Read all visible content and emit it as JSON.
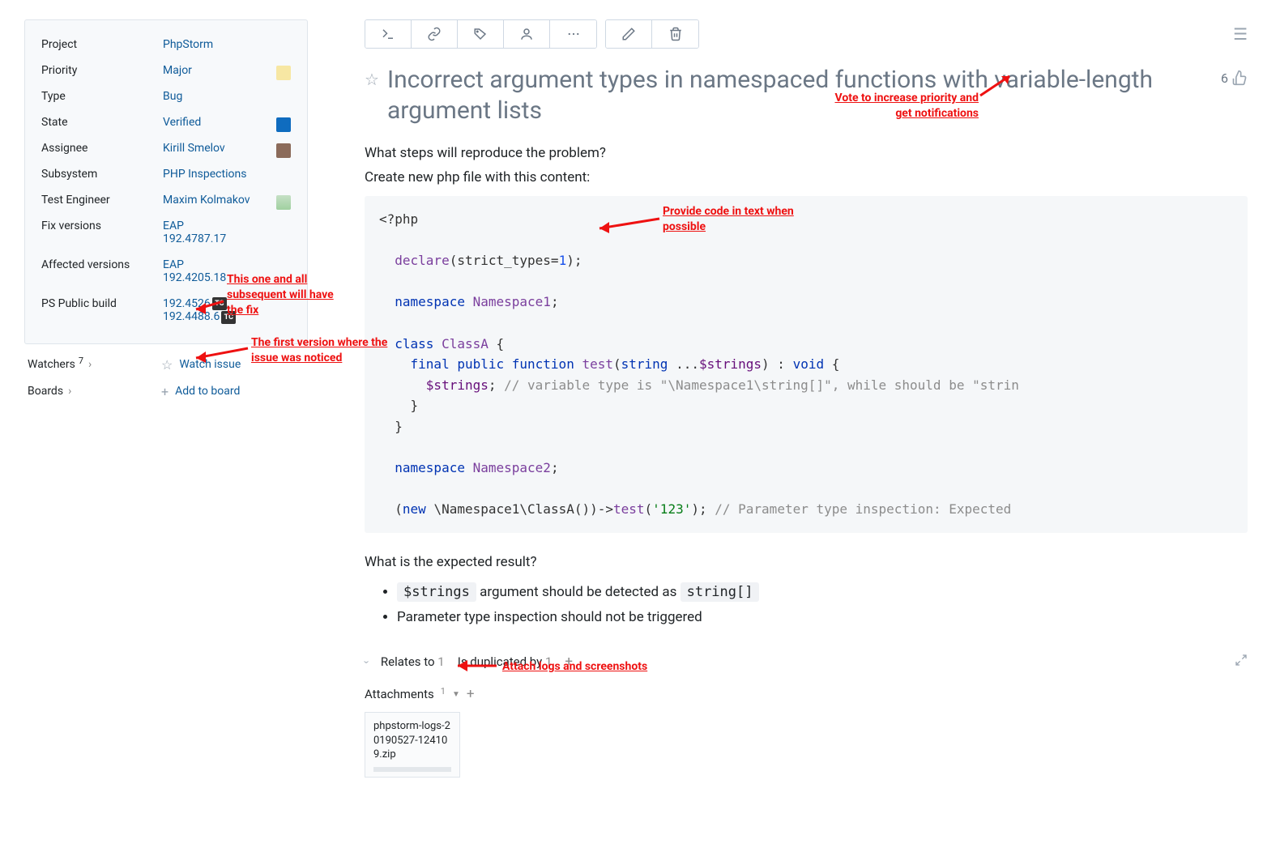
{
  "sidebar": {
    "fields": {
      "project": {
        "label": "Project",
        "value": "PhpStorm"
      },
      "priority": {
        "label": "Priority",
        "value": "Major"
      },
      "type": {
        "label": "Type",
        "value": "Bug"
      },
      "state": {
        "label": "State",
        "value": "Verified"
      },
      "assignee": {
        "label": "Assignee",
        "value": "Kirill Smelov"
      },
      "subsystem": {
        "label": "Subsystem",
        "value": "PHP Inspections"
      },
      "test_engineer": {
        "label": "Test Engineer",
        "value": "Maxim Kolmakov"
      },
      "fix_versions": {
        "label": "Fix versions",
        "v1": "EAP",
        "v2": "192.4787.17"
      },
      "affected_versions": {
        "label": "Affected versions",
        "v1": "EAP",
        "v2": "192.4205.18"
      },
      "ps_build": {
        "label": "PS Public build",
        "v1": "192.4526",
        "v2": "192.4488.6"
      }
    },
    "watchers": {
      "label": "Watchers",
      "count": "7"
    },
    "watch_issue": "Watch issue",
    "boards": {
      "label": "Boards"
    },
    "add_to_board": "Add to board"
  },
  "issue": {
    "title": "Incorrect argument types in namespaced functions with variable-length argument lists",
    "votes": "6",
    "q1": "What steps will reproduce the problem?",
    "q1_sub": "Create new php file with this content:",
    "q2": "What is the expected result?",
    "expect1_a": "$strings",
    "expect1_b": " argument should be detected as ",
    "expect1_c": "string[]",
    "expect2": "Parameter type inspection should not be triggered"
  },
  "links": {
    "relates_label": "Relates to",
    "relates_count": "1",
    "dup_label": "Is duplicated by",
    "dup_count": "1"
  },
  "attachments": {
    "label": "Attachments",
    "count": "1",
    "file": "phpstorm-logs-20190527-124109.zip"
  },
  "annotations": {
    "vote": "Vote to increase priority and get notifications",
    "code": "Provide code in text when possible",
    "fix": "This one and all subsequent will have the fix",
    "affected": "The first version where the issue was noticed",
    "attach": "Attach logs and screenshots"
  }
}
